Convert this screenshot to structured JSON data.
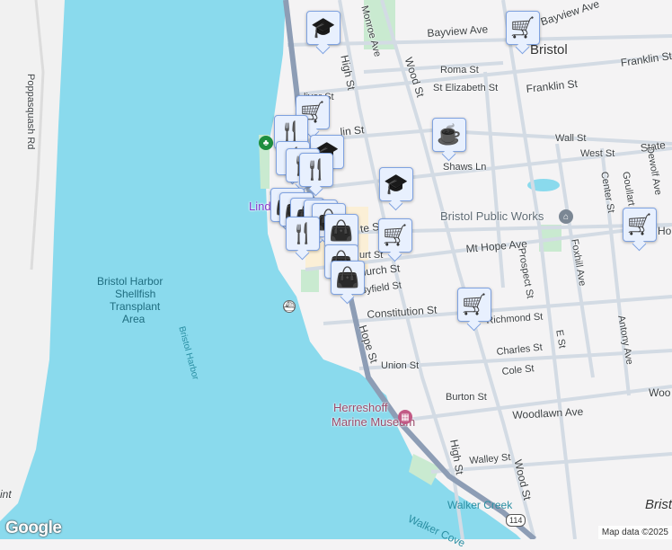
{
  "map": {
    "water_color": "#8adaed",
    "land_color": "#f4f3f4",
    "park_color": "#c9ead0",
    "road_color": "#c9d3de",
    "highway_color": "#8d9db5",
    "marker_color": "#0d4369"
  },
  "labels": {
    "bristol": "Bristol",
    "bristol_edge": "Brist",
    "bayview_ave": "Bayview Ave",
    "bayview_ave_top": "Bayview Ave",
    "franklin_st": "Franklin St",
    "franklin_st_right": "Franklin St",
    "franklin_st_left": "lin St",
    "roma_st": "Roma St",
    "st_elizabeth_st": "St Elizabeth St",
    "oliver_st": "liver St",
    "monroe_ave": "Monroe Ave",
    "high_st": "High St",
    "high_st_south": "High St",
    "wood_st": "Wood St",
    "wood_st_south": "Wood St",
    "wall_st": "Wall St",
    "west_st": "West St",
    "state_st": "State",
    "shaws_ln": "Shaws Ln",
    "center_st": "Center St",
    "goullart_ave": "Goullart Ave",
    "dewolf_ave": "Dewolf Ave",
    "bristol_public_works": "Bristol Public Works",
    "mt_hope_ave": "Mt Hope Ave",
    "hop": "Hop",
    "church_st": "hurch St",
    "court_st": "urt St",
    "state_st_left": "te St",
    "byfield_st": "Byfield St",
    "constitution_st": "Constitution St",
    "richmond_st": "Richmond St",
    "prospect_st": "Prospect St",
    "fox_hill_ave": "Foxhill Ave",
    "e_st": "E St",
    "charles_st": "Charles St",
    "cole_st": "Cole St",
    "union_st": "Union St",
    "burton_st": "Burton St",
    "antony_ave": "Antony Ave",
    "woo": "Woo",
    "woodlawn_ave": "Woodlawn Ave",
    "walley_st": "Walley St",
    "hope_st": "Hope St",
    "herreshoff": "Herreshoff",
    "marine_museum": "Marine Museum",
    "walker_creek": "Walker Creek",
    "walker_cove": "Walker Cove",
    "bristol_harbor": "Bristol Harbor",
    "shellfish_1": "Bristol Harbor",
    "shellfish_2": "Shellfish",
    "shellfish_3": "Transplant",
    "shellfish_4": "Area",
    "poppasquash_rd": "Poppasquash Rd",
    "linden": "Lind",
    "point": "int",
    "route_114": "114"
  },
  "markers": [
    {
      "type": "school"
    },
    {
      "type": "grocery"
    },
    {
      "type": "grocery"
    },
    {
      "type": "restaurant"
    },
    {
      "type": "school"
    },
    {
      "type": "restaurant"
    },
    {
      "type": "restaurant"
    },
    {
      "type": "restaurant"
    },
    {
      "type": "shopping"
    },
    {
      "type": "shopping"
    },
    {
      "type": "shopping"
    },
    {
      "type": "restaurant"
    },
    {
      "type": "shopping"
    },
    {
      "type": "restaurant"
    },
    {
      "type": "shopping"
    },
    {
      "type": "cafe"
    },
    {
      "type": "school"
    },
    {
      "type": "grocery"
    },
    {
      "type": "grocery"
    },
    {
      "type": "grocery"
    }
  ],
  "attribution": {
    "logo": "Google",
    "text": "Map data ©2025"
  }
}
